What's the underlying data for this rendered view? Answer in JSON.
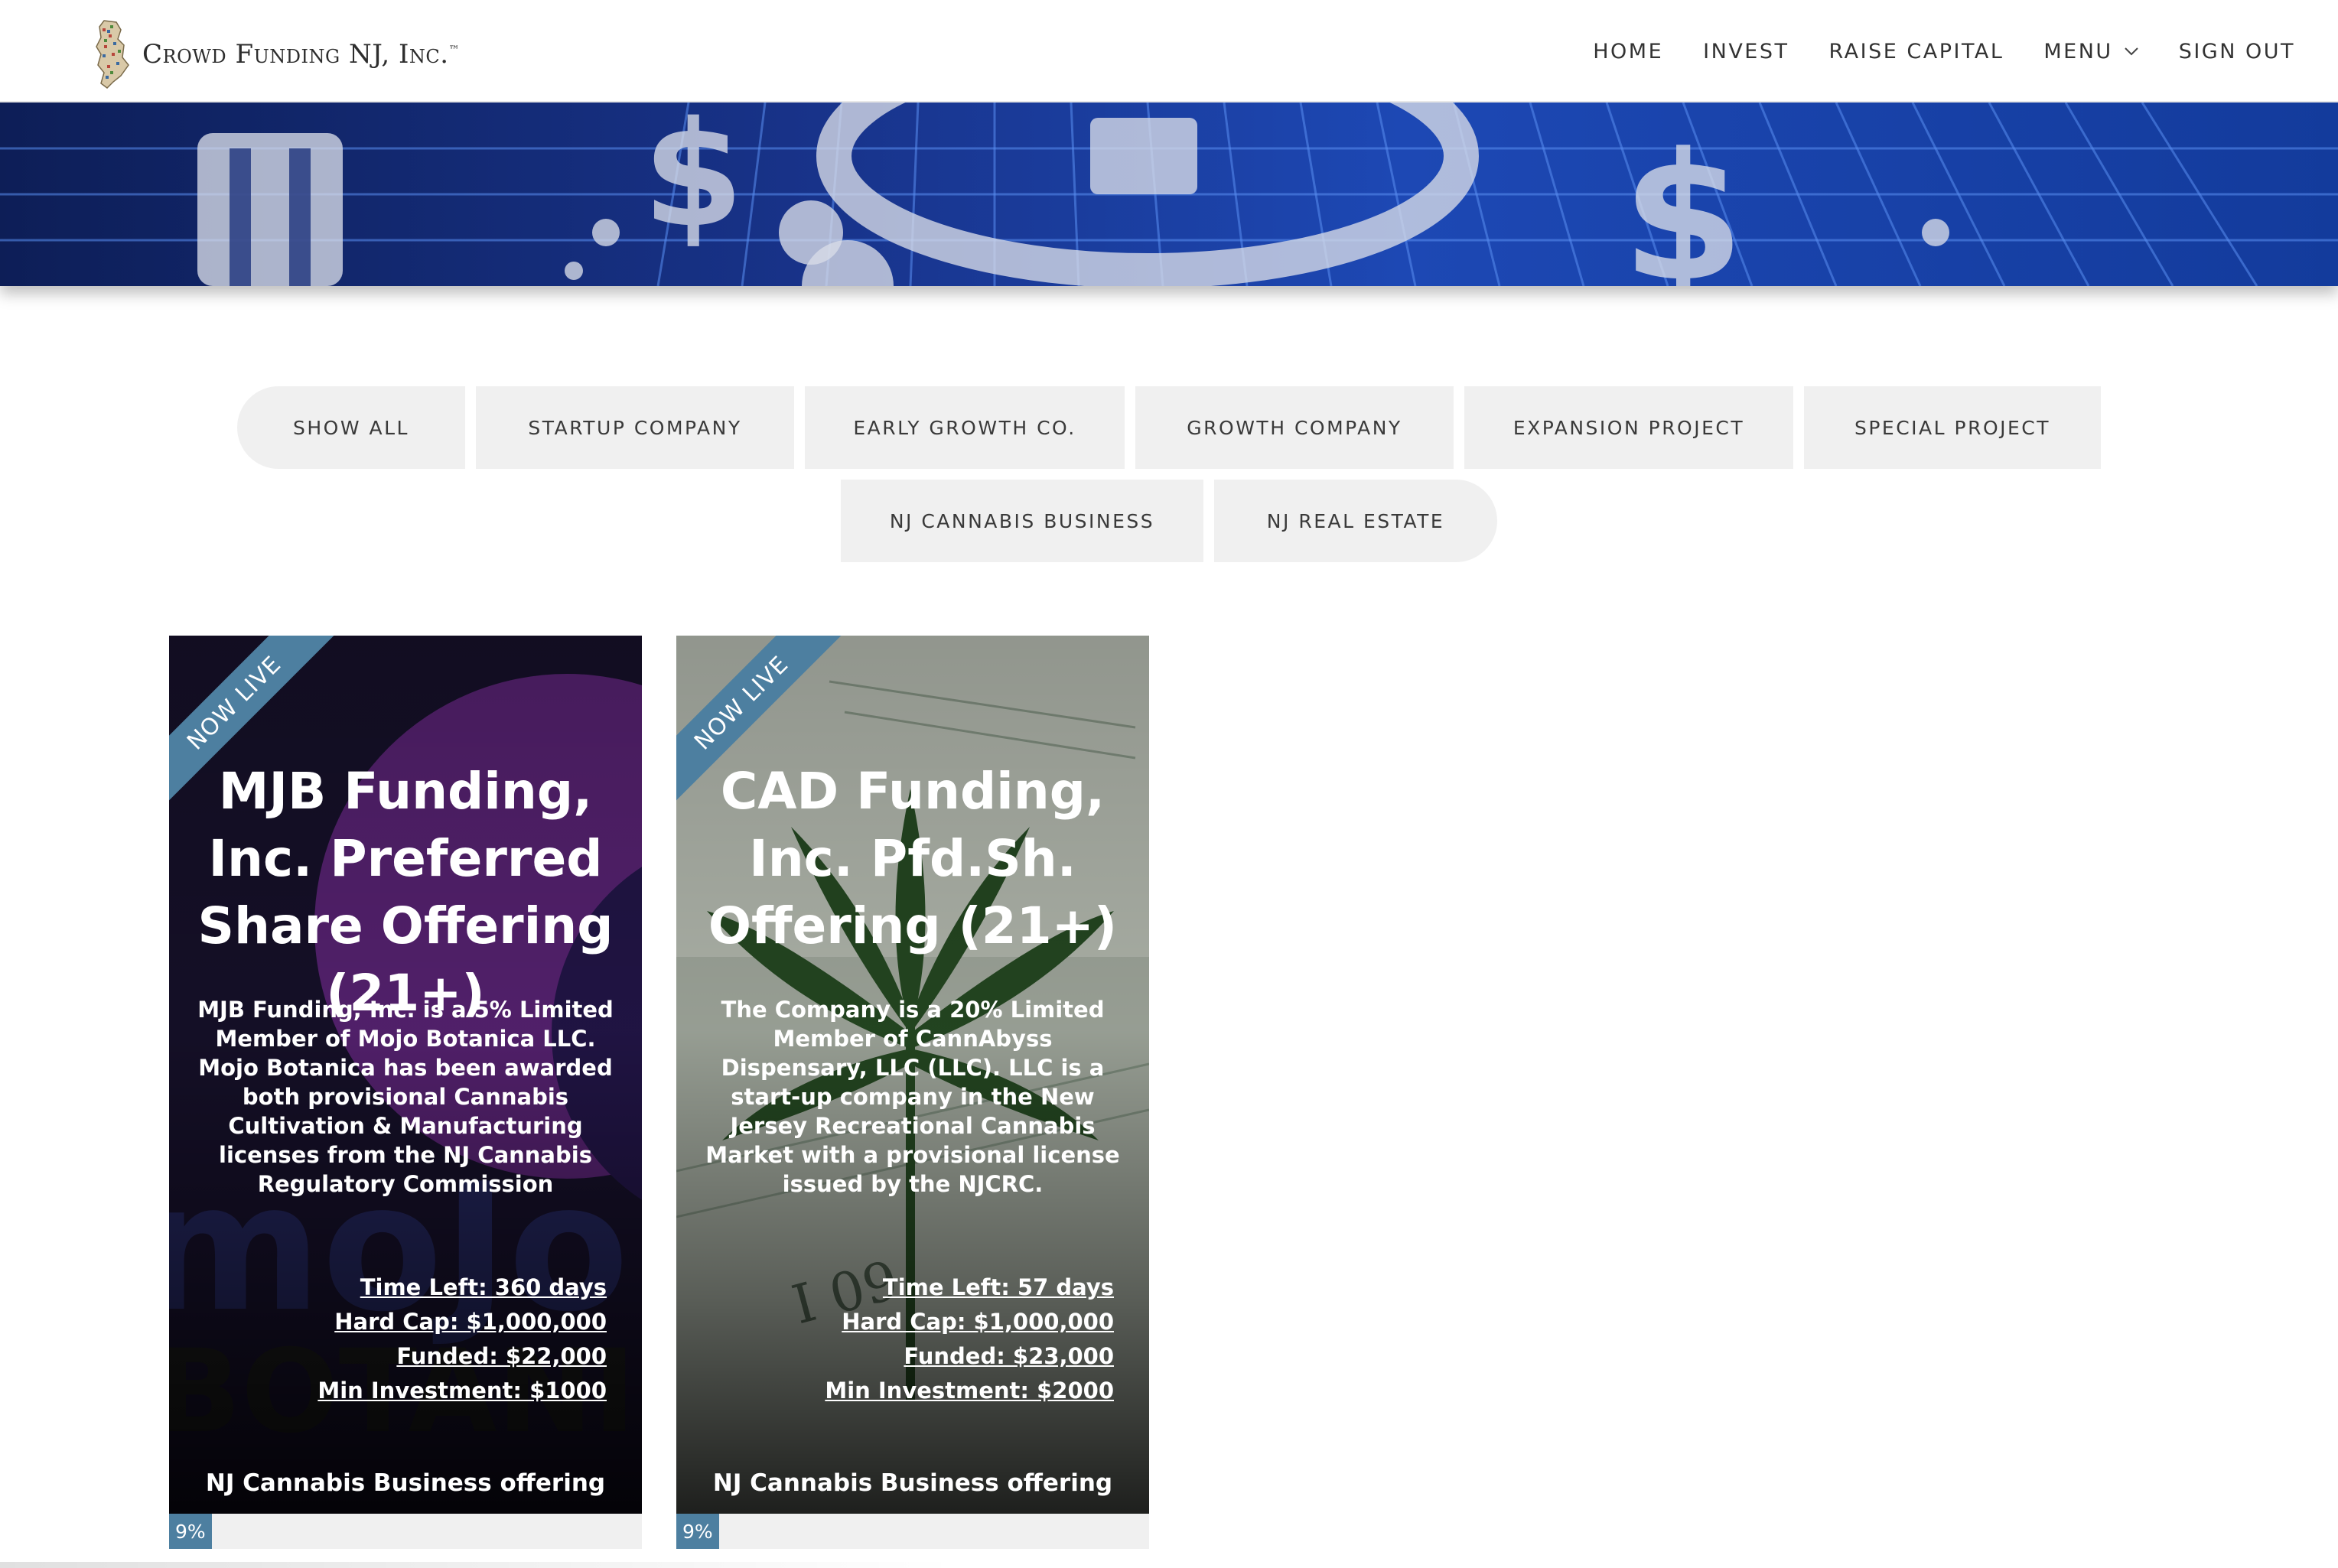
{
  "header": {
    "logo_text": "Crowd Funding NJ, Inc.",
    "logo_tm": "™",
    "nav": [
      {
        "label": "HOME"
      },
      {
        "label": "INVEST"
      },
      {
        "label": "RAISE CAPITAL"
      },
      {
        "label": "MENU"
      },
      {
        "label": "SIGN OUT"
      }
    ]
  },
  "filters": {
    "row1": [
      "SHOW ALL",
      "STARTUP COMPANY",
      "EARLY GROWTH CO.",
      "GROWTH COMPANY",
      "EXPANSION PROJECT",
      "SPECIAL PROJECT"
    ],
    "row2": [
      "NJ CANNABIS BUSINESS",
      "NJ REAL ESTATE"
    ]
  },
  "cards": [
    {
      "ribbon": "NOW LIVE",
      "title": "MJB Funding, Inc. Preferred Share Offering (21+)",
      "description": "MJB Funding, Inc. is a 5% Limited Member of Mojo Botanica LLC. Mojo Botanica has been awarded both provisional Cannabis Cultivation & Manufacturing licenses from the NJ Cannabis Regulatory Commission",
      "time_left": "Time Left: 360 days",
      "hard_cap": "Hard Cap: $1,000,000",
      "funded": "Funded: $22,000",
      "min_investment": "Min Investment: $1000",
      "category": "NJ Cannabis Business offering",
      "progress_label": "9%",
      "progress": 0.09,
      "bg_accent": "#6b2a8c"
    },
    {
      "ribbon": "NOW LIVE",
      "title": "CAD Funding, Inc. Pfd.Sh. Offering (21+)",
      "description": "The Company is a 20% Limited Member of CannAbyss Dispensary, LLC (LLC). LLC is a start-up company in the New Jersey Recreational Cannabis Market with a provisional license issued by the NJCRC.",
      "time_left": "Time Left: 57 days",
      "hard_cap": "Hard Cap: $1,000,000",
      "funded": "Funded: $23,000",
      "min_investment": "Min Investment: $2000",
      "category": "NJ Cannabis Business offering",
      "progress_label": "9%",
      "progress": 0.09,
      "bg_accent": "#3f6a3a"
    }
  ],
  "colors": {
    "ribbon": "#4d7fa0",
    "filter_bg": "#f0f0f0",
    "banner": "#18338a"
  }
}
